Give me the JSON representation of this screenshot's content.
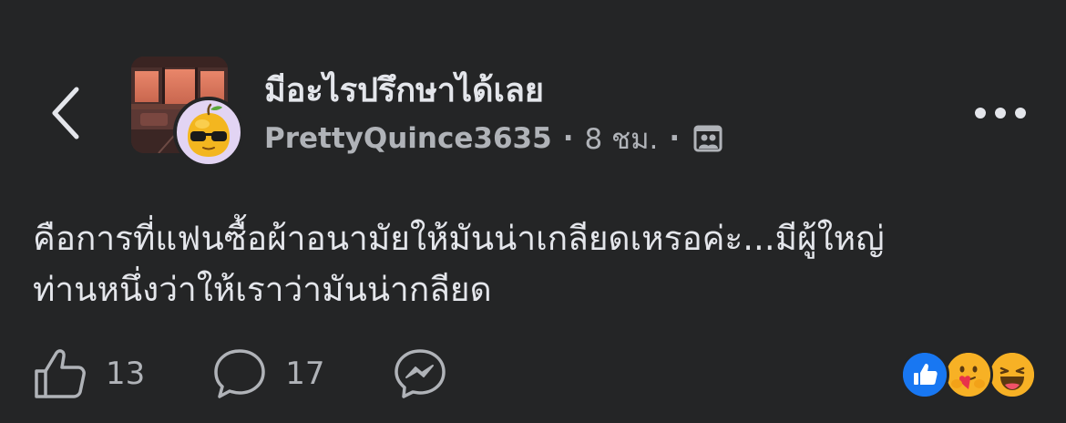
{
  "header": {
    "group_name": "มีอะไรปรึกษาได้เลย",
    "author": "PrettyQuince3635",
    "separator": "·",
    "time": "8 ชม.",
    "back_icon": "chevron-left-icon",
    "more_icon": "more-horizontal-icon",
    "audience_icon": "group-audience-icon"
  },
  "post": {
    "line1": "คือการที่แฟนซื้อผ้าอนามัยให้มันน่าเกลียดเหรอค่ะ...มีผู้ใหญ่",
    "line2": "ท่านหนึ่งว่าให้เราว่ามันน่ากลียด"
  },
  "actions": {
    "like_count": "13",
    "comment_count": "17",
    "like_icon": "thumbs-up-icon",
    "comment_icon": "comment-bubble-icon",
    "share_icon": "messenger-icon"
  },
  "reactions": [
    "like-reaction-icon",
    "care-reaction-icon",
    "haha-reaction-icon"
  ],
  "colors": {
    "background": "#242526",
    "primary_text": "#e4e6eb",
    "secondary_text": "#b0b3b8",
    "like_blue": "#1877f2"
  }
}
